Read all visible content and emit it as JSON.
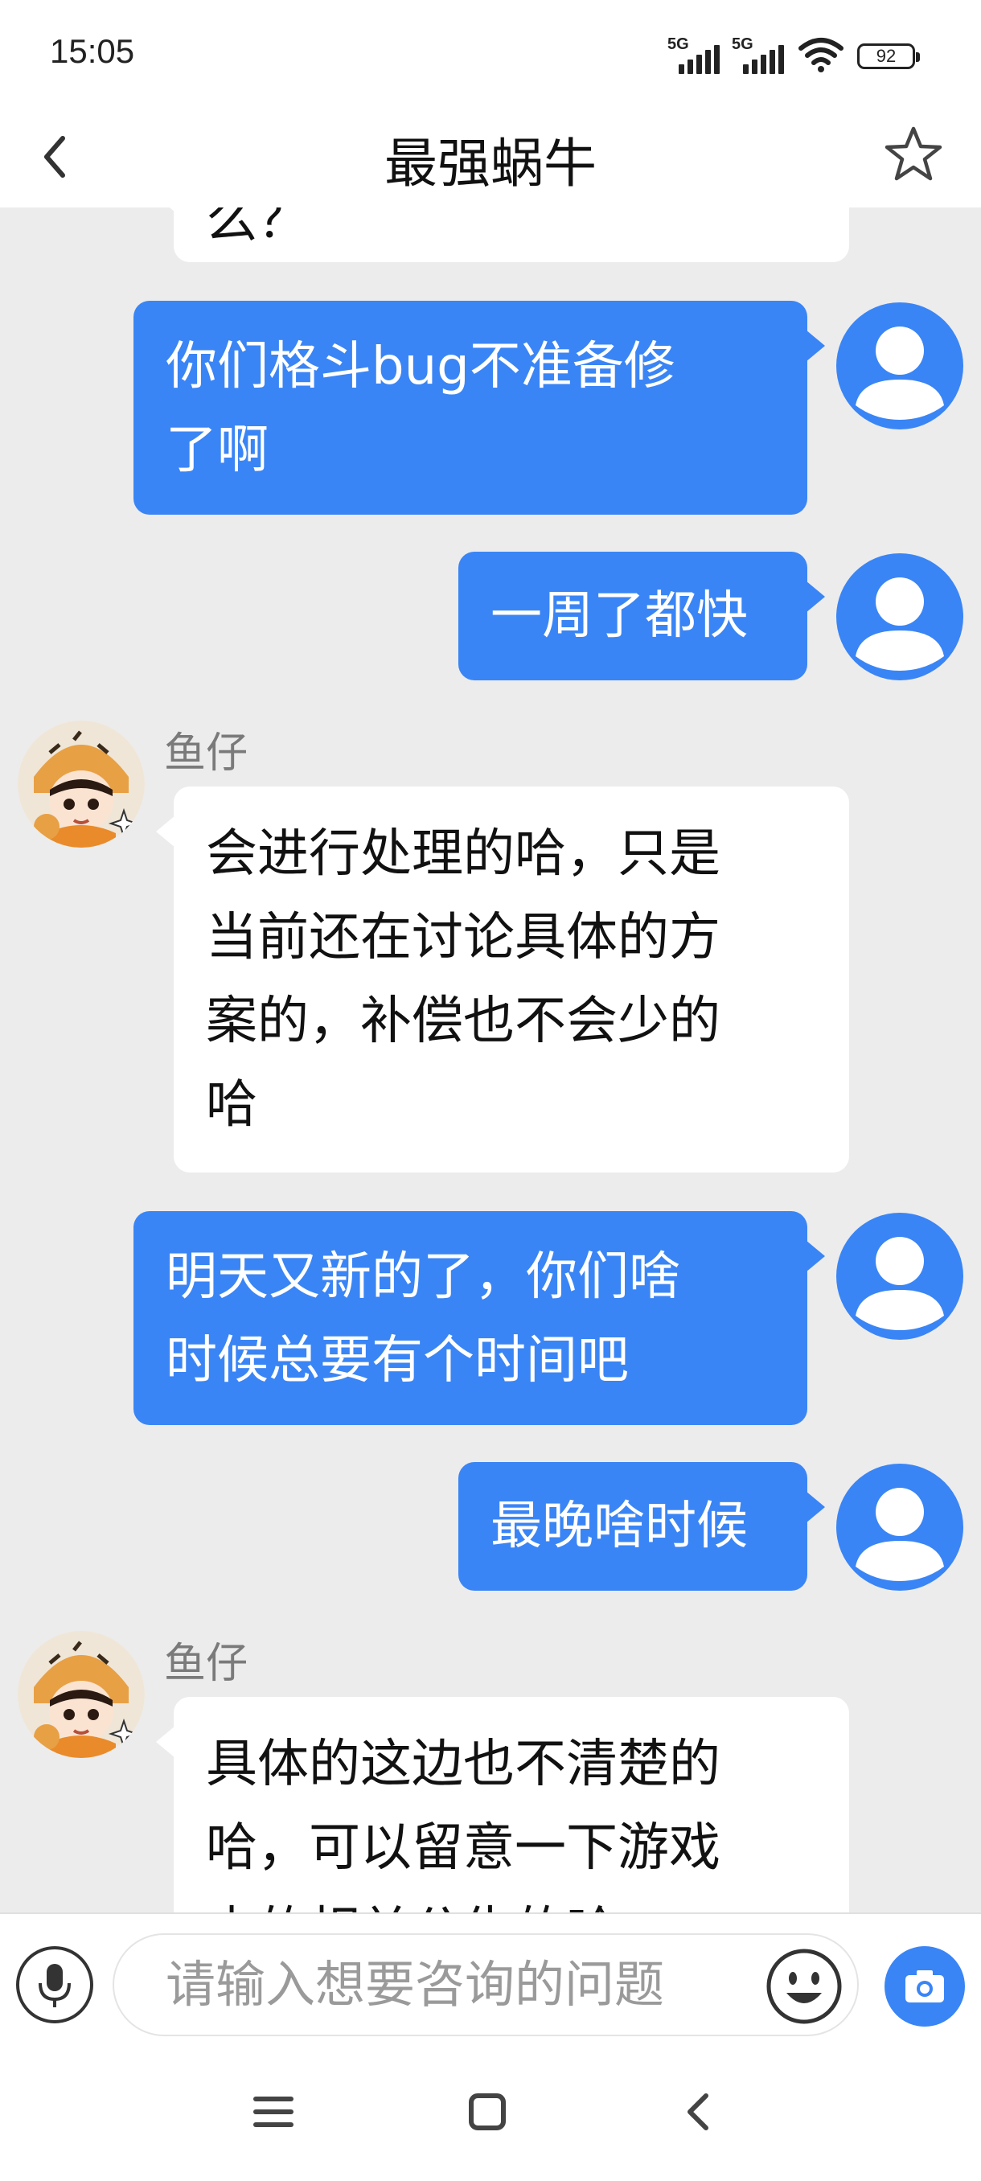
{
  "status_bar": {
    "time": "15:05",
    "signal1": "5G",
    "signal2": "5G",
    "battery": "92"
  },
  "header": {
    "title": "最强蜗牛",
    "back_icon": "chevron-left-icon",
    "favorite_icon": "star-outline-icon"
  },
  "chat": {
    "partial_top": "么？",
    "messages": [
      {
        "from": "user",
        "lines": [
          "你们格斗bug不准备修",
          "了啊"
        ]
      },
      {
        "from": "user",
        "lines": [
          "一周了都快"
        ]
      },
      {
        "from": "agent",
        "sender": "鱼仔",
        "lines": [
          "会进行处理的哈，只是",
          "当前还在讨论具体的方",
          "案的，补偿也不会少的",
          "哈"
        ]
      },
      {
        "from": "user",
        "lines": [
          "明天又新的了，你们啥",
          "时候总要有个时间吧"
        ]
      },
      {
        "from": "user",
        "lines": [
          "最晚啥时候"
        ]
      },
      {
        "from": "agent",
        "sender": "鱼仔",
        "lines": [
          "具体的这边也不清楚的",
          "哈，可以留意一下游戏",
          "内的相关公告的哈"
        ]
      }
    ]
  },
  "input_bar": {
    "placeholder": "请输入想要咨询的问题",
    "mic_icon": "microphone-icon",
    "emoji_icon": "smiley-icon",
    "camera_icon": "camera-icon"
  },
  "nav_bar": {
    "icons": [
      "menu-icon",
      "home-square-icon",
      "back-chevron-icon"
    ]
  },
  "colors": {
    "accent": "#3a85f5",
    "background": "#ececec",
    "bubble_in": "#ffffff"
  }
}
